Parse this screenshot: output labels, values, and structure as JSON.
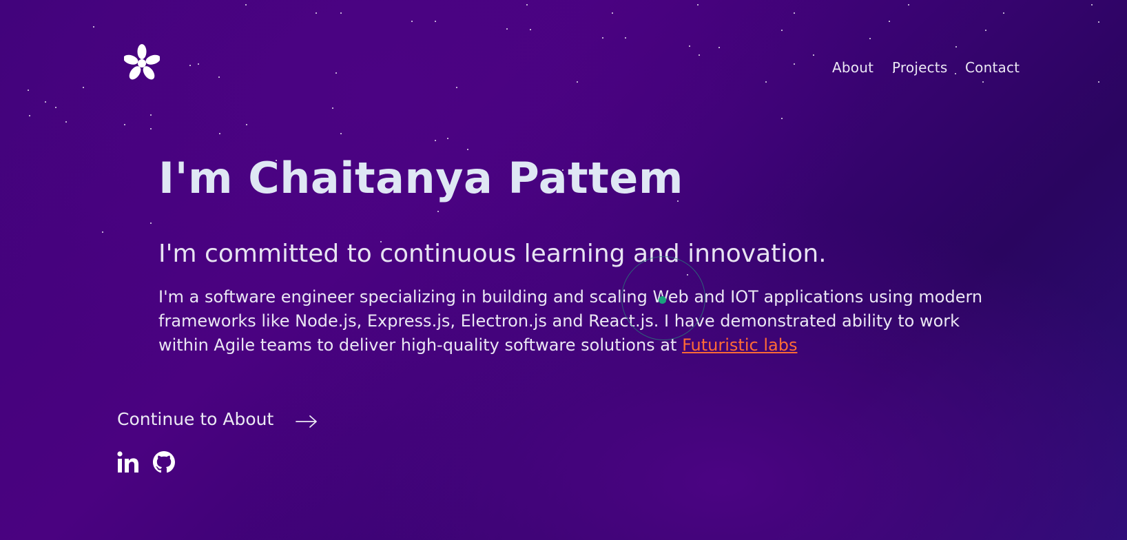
{
  "header": {
    "logo_icon": "asterisk-logo-icon",
    "nav": [
      {
        "label": "About"
      },
      {
        "label": "Projects"
      },
      {
        "label": "Contact"
      }
    ]
  },
  "hero": {
    "title": "I'm Chaitanya Pattem",
    "tagline": "I'm committed to continuous learning and innovation.",
    "bio_text": "I'm a software engineer specializing in building and scaling Web and IOT applications using modern frameworks like Node.js, Express.js, Electron.js and React.js. I have demonstrated ability to work within Agile teams to deliver high-quality software solutions at ",
    "bio_link": "Futuristic labs"
  },
  "cta": {
    "label": "Continue to About",
    "icon": "arrow-right-icon"
  },
  "socials": [
    {
      "icon": "linkedin-icon"
    },
    {
      "icon": "github-icon"
    }
  ],
  "colors": {
    "background": "#42037d",
    "text": "#e9e6f4",
    "title": "#dfe7f4",
    "link": "#ff6b35",
    "cursor": "#1aa27e"
  }
}
